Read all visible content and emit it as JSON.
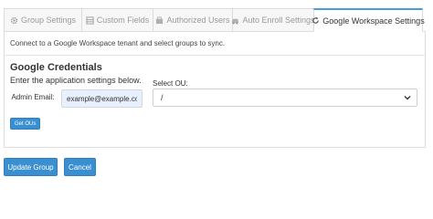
{
  "tabs": [
    {
      "label": "Group Settings",
      "icon": "gear-icon",
      "active": false
    },
    {
      "label": "Custom Fields",
      "icon": "list-icon",
      "active": false
    },
    {
      "label": "Authorized Users",
      "icon": "users-icon",
      "active": false
    },
    {
      "label": "Auto Enroll Settings",
      "icon": "car-icon",
      "active": false
    },
    {
      "label": "Google Workspace Settings",
      "icon": "refresh-icon",
      "active": true
    }
  ],
  "panel": {
    "intro": "Connect to a Google Workspace tenant and select groups to sync.",
    "credentials_title": "Google Credentials",
    "instructions": "Enter the application settings below.",
    "admin_email_label": "Admin Email:",
    "admin_email_value": "example@example.com",
    "ou_label": "Select OU:",
    "ou_value": "/",
    "get_ous_label": "Get OUs"
  },
  "footer": {
    "update_label": "Update Group",
    "cancel_label": "Cancel"
  },
  "colors": {
    "accent": "#3a8fd1",
    "active_tab_border": "#4a9cd6",
    "input_autofill": "#e8f0fe"
  }
}
